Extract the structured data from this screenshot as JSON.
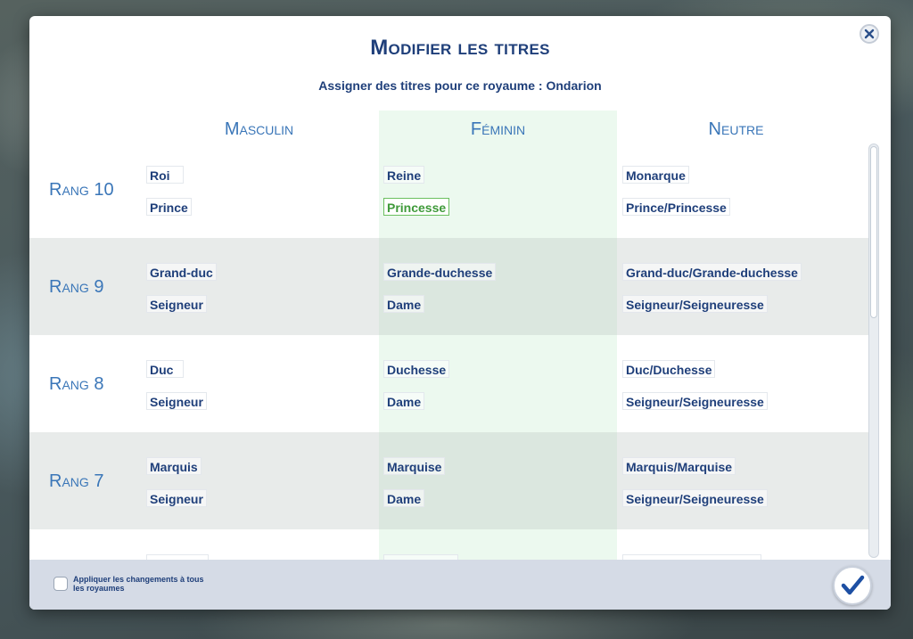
{
  "dialog": {
    "title": "Modifier les titres",
    "subtitle": "Assigner des titres pour ce royaume : Ondarion",
    "close_icon": "close-icon",
    "confirm_icon": "checkmark-icon"
  },
  "columns": {
    "masculine": "Masculin",
    "feminine": "Féminin",
    "neutral": "Neutre"
  },
  "ranks": [
    {
      "label": "Rang 10",
      "masculine": [
        "Roi",
        "Prince"
      ],
      "feminine": [
        "Reine",
        "Princesse"
      ],
      "neutral": [
        "Monarque",
        "Prince/Princesse"
      ]
    },
    {
      "label": "Rang 9",
      "masculine": [
        "Grand-duc",
        "Seigneur"
      ],
      "feminine": [
        "Grande-duchesse",
        "Dame"
      ],
      "neutral": [
        "Grand-duc/Grande-duchesse",
        "Seigneur/Seigneuresse"
      ]
    },
    {
      "label": "Rang 8",
      "masculine": [
        "Duc",
        "Seigneur"
      ],
      "feminine": [
        "Duchesse",
        "Dame"
      ],
      "neutral": [
        "Duc/Duchesse",
        "Seigneur/Seigneuresse"
      ]
    },
    {
      "label": "Rang 7",
      "masculine": [
        "Marquis",
        "Seigneur"
      ],
      "feminine": [
        "Marquise",
        "Dame"
      ],
      "neutral": [
        "Marquis/Marquise",
        "Seigneur/Seigneuresse"
      ]
    }
  ],
  "footer": {
    "apply_all_label": "Appliquer les changements à tous les royaumes"
  },
  "colors": {
    "title": "#1f3f7a",
    "header": "#3a76b8",
    "active_field": "#3f9a3a",
    "feminine_column": "#bceac4"
  }
}
